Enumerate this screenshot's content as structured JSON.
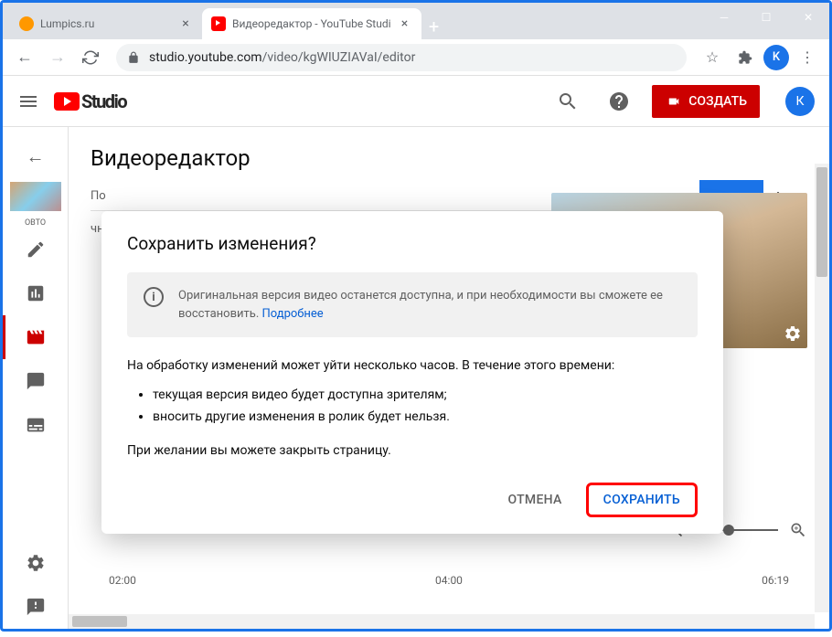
{
  "browser": {
    "tabs": [
      {
        "title": "Lumpics.ru",
        "favicon_color": "#ff9800",
        "active": false
      },
      {
        "title": "Видеоредактор - YouTube Studi",
        "favicon_color": "#ff0000",
        "active": true
      }
    ],
    "url_host": "studio.youtube.com",
    "url_path": "/video/kgWIUZIAVaI/editor",
    "profile_letter": "K"
  },
  "header": {
    "logo_text": "Studio",
    "create_label": "СОЗДАТЬ",
    "avatar_letter": "К"
  },
  "sidebar": {
    "caption": "ОВТО"
  },
  "editor": {
    "page_title": "Видеоредактор",
    "section1": "По",
    "section2": "чное",
    "timeline": {
      "t1": "02:00",
      "t2": "04:00",
      "t3": "06:19"
    }
  },
  "modal": {
    "title": "Сохранить изменения?",
    "info_text": "Оригинальная версия видео останется доступна, и при необходимости вы сможете ее восстановить. ",
    "info_link": "Подробнее",
    "body_intro": "На обработку изменений может уйти несколько часов. В течение этого времени:",
    "bullet1": "текущая версия видео будет доступна зрителям;",
    "bullet2": "вносить другие изменения в ролик будет нельзя.",
    "body_close": "При желании вы можете закрыть страницу.",
    "cancel_label": "ОТМЕНА",
    "save_label": "СОХРАНИТЬ"
  }
}
